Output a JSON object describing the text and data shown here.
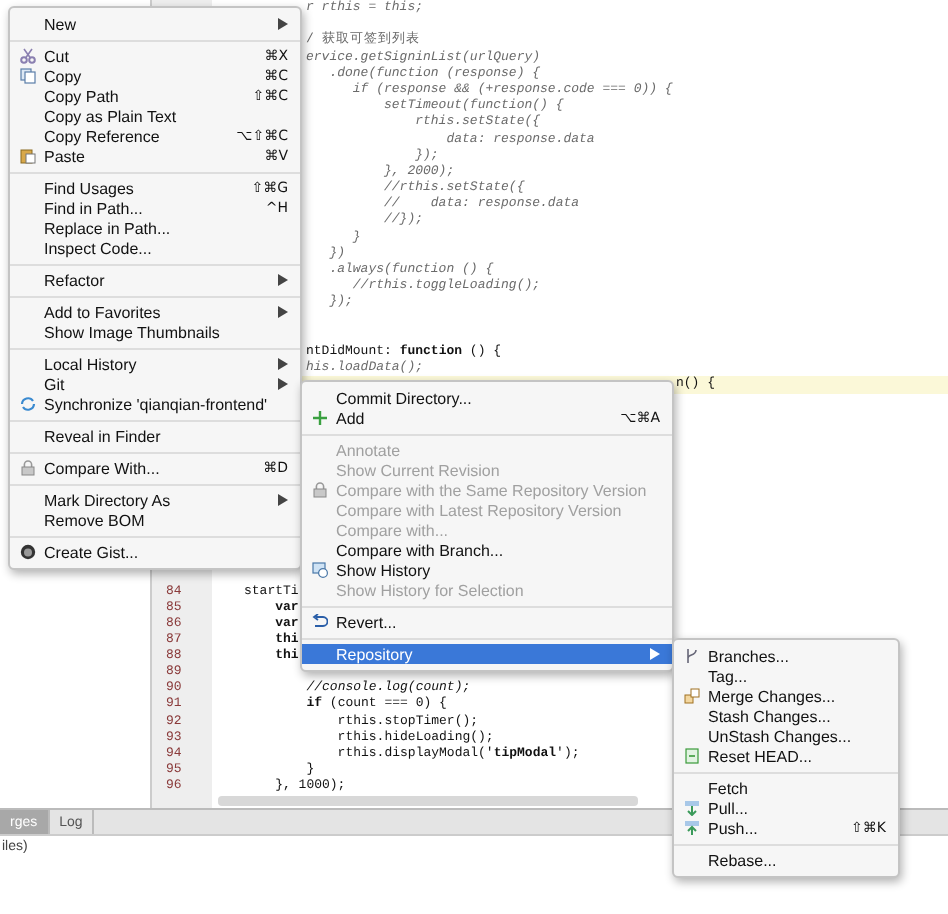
{
  "editor": {
    "top_lines": [
      {
        "kind": "dim",
        "text": "r rthis = this;"
      },
      {
        "kind": "blank"
      },
      {
        "kind": "cjk",
        "text": "/ 获取可签到列表"
      },
      {
        "kind": "dim",
        "text": "ervice.getSigninList(urlQuery)"
      },
      {
        "kind": "dim",
        "text": "   .done(function (response) {"
      },
      {
        "kind": "dim",
        "text": "      if (response && (+response.code === 0)) {"
      },
      {
        "kind": "dim",
        "text": "          setTimeout(function() {"
      },
      {
        "kind": "dim",
        "text": "              rthis.setState({"
      },
      {
        "kind": "dim",
        "text": "                  data: response.data"
      },
      {
        "kind": "dim",
        "text": "              });"
      },
      {
        "kind": "dim",
        "text": "          }, 2000);"
      },
      {
        "kind": "dim",
        "text": "          //rthis.setState({"
      },
      {
        "kind": "dim",
        "text": "          //    data: response.data"
      },
      {
        "kind": "dim",
        "text": "          //});"
      },
      {
        "kind": "dim",
        "text": "      }"
      },
      {
        "kind": "dim",
        "text": "   })"
      },
      {
        "kind": "dim",
        "text": "   .always(function () {"
      },
      {
        "kind": "dim",
        "text": "      //rthis.toggleLoading();"
      },
      {
        "kind": "dim",
        "text": "   });"
      },
      {
        "kind": "blank"
      },
      {
        "kind": "blank"
      },
      {
        "kind": "code",
        "text": "ntDidMount: **function** () {"
      },
      {
        "kind": "dim",
        "text": "his.loadData();"
      },
      {
        "kind": "highlighted",
        "text": "n() {"
      }
    ],
    "numbered_lines": [
      {
        "number": "84",
        "code": "startTi"
      },
      {
        "number": "85",
        "code": "    **var**"
      },
      {
        "number": "86",
        "code": "    **var**"
      },
      {
        "number": "87",
        "code": "    **thi**"
      },
      {
        "number": "88",
        "code": "    **thi**"
      },
      {
        "number": "89"
      },
      {
        "number": "90",
        "code": "        *//console.log(count);*"
      },
      {
        "number": "91",
        "code": "        **if** (count === 0) {"
      },
      {
        "number": "92",
        "code": "            rthis.stopTimer();"
      },
      {
        "number": "93",
        "code": "            rthis.hideLoading();"
      },
      {
        "number": "94",
        "code": "            rthis.displayModal('**tipModal**');"
      },
      {
        "number": "95",
        "code": "        }"
      },
      {
        "number": "96",
        "code": "    }, 1000);"
      }
    ]
  },
  "bottom_panel": {
    "tabs": [
      {
        "label": "rges",
        "selected": true
      },
      {
        "label": "Log",
        "selected": false
      }
    ],
    "text": "iles)"
  },
  "menus": [
    {
      "groups": [
        [
          {
            "label": "New",
            "submenu": true,
            "selected": false
          }
        ],
        [
          {
            "label": "Cut",
            "kind": "cut",
            "shortcut": "⌘X",
            "selected": false
          },
          {
            "label": "Copy",
            "kind": "copy",
            "shortcut": "⌘C",
            "selected": false
          },
          {
            "label": "Copy Path",
            "shortcut": "⇧⌘C",
            "selected": false
          },
          {
            "label": "Copy as Plain Text",
            "selected": false
          },
          {
            "label": "Copy Reference",
            "shortcut": "⌥⇧⌘C",
            "selected": false
          },
          {
            "label": "Paste",
            "kind": "paste",
            "shortcut": "⌘V",
            "selected": false
          }
        ],
        [
          {
            "label": "Find Usages",
            "shortcut": "⇧⌘G",
            "selected": false
          },
          {
            "label": "Find in Path...",
            "shortcut": "^H",
            "selected": false
          },
          {
            "label": "Replace in Path...",
            "selected": false
          },
          {
            "label": "Inspect Code...",
            "selected": false
          }
        ],
        [
          {
            "label": "Refactor",
            "submenu": true,
            "selected": false
          }
        ],
        [
          {
            "label": "Add to Favorites",
            "submenu": true,
            "selected": false
          },
          {
            "label": "Show Image Thumbnails",
            "selected": false
          }
        ],
        [
          {
            "label": "Local History",
            "submenu": true,
            "selected": false
          },
          {
            "label": "Git",
            "submenu": true,
            "selected": false
          },
          {
            "label": "Synchronize 'qianqian-frontend'",
            "kind": "sync",
            "selected": false
          }
        ],
        [
          {
            "label": "Reveal in Finder",
            "selected": false
          }
        ],
        [
          {
            "label": "Compare With...",
            "kind": "lock",
            "shortcut": "⌘D",
            "selected": false
          }
        ],
        [
          {
            "label": "Mark Directory As",
            "submenu": true,
            "selected": false
          },
          {
            "label": "Remove BOM",
            "selected": false
          }
        ],
        [
          {
            "label": "Create Gist...",
            "kind": "gist",
            "selected": false
          }
        ]
      ]
    },
    {
      "groups": [
        [
          {
            "label": "Commit Directory...",
            "disabled": false,
            "selected": false
          },
          {
            "label": "Add",
            "kind": "add",
            "shortcut": "⌥⌘A",
            "disabled": false,
            "selected": false
          }
        ],
        [
          {
            "label": "Annotate",
            "disabled": true,
            "selected": false
          },
          {
            "label": "Show Current Revision",
            "disabled": true,
            "selected": false
          },
          {
            "label": "Compare with the Same Repository Version",
            "kind": "lock",
            "disabled": true,
            "selected": false
          },
          {
            "label": "Compare with Latest Repository Version",
            "disabled": true,
            "selected": false
          },
          {
            "label": "Compare with...",
            "disabled": true,
            "selected": false
          },
          {
            "label": "Compare with Branch...",
            "disabled": false,
            "selected": false
          },
          {
            "label": "Show History",
            "kind": "history",
            "disabled": false,
            "selected": false
          },
          {
            "label": "Show History for Selection",
            "disabled": true,
            "selected": false
          }
        ],
        [
          {
            "label": "Revert...",
            "kind": "revert",
            "disabled": false,
            "selected": false
          }
        ],
        [
          {
            "label": "Repository",
            "submenu": true,
            "disabled": false,
            "selected": true
          }
        ]
      ]
    },
    {
      "groups": [
        [
          {
            "label": "Branches...",
            "kind": "branches",
            "selected": false
          },
          {
            "label": "Tag...",
            "selected": false
          },
          {
            "label": "Merge Changes...",
            "kind": "merge",
            "selected": false
          },
          {
            "label": "Stash Changes...",
            "selected": false
          },
          {
            "label": "UnStash Changes...",
            "selected": false
          },
          {
            "label": "Reset HEAD...",
            "kind": "reset",
            "selected": false
          }
        ],
        [
          {
            "label": "Fetch",
            "selected": false
          },
          {
            "label": "Pull...",
            "kind": "pull",
            "selected": false
          },
          {
            "label": "Push...",
            "kind": "push",
            "shortcut": "⇧⌘K",
            "selected": false
          }
        ],
        [
          {
            "label": "Rebase...",
            "selected": false
          }
        ]
      ]
    }
  ]
}
